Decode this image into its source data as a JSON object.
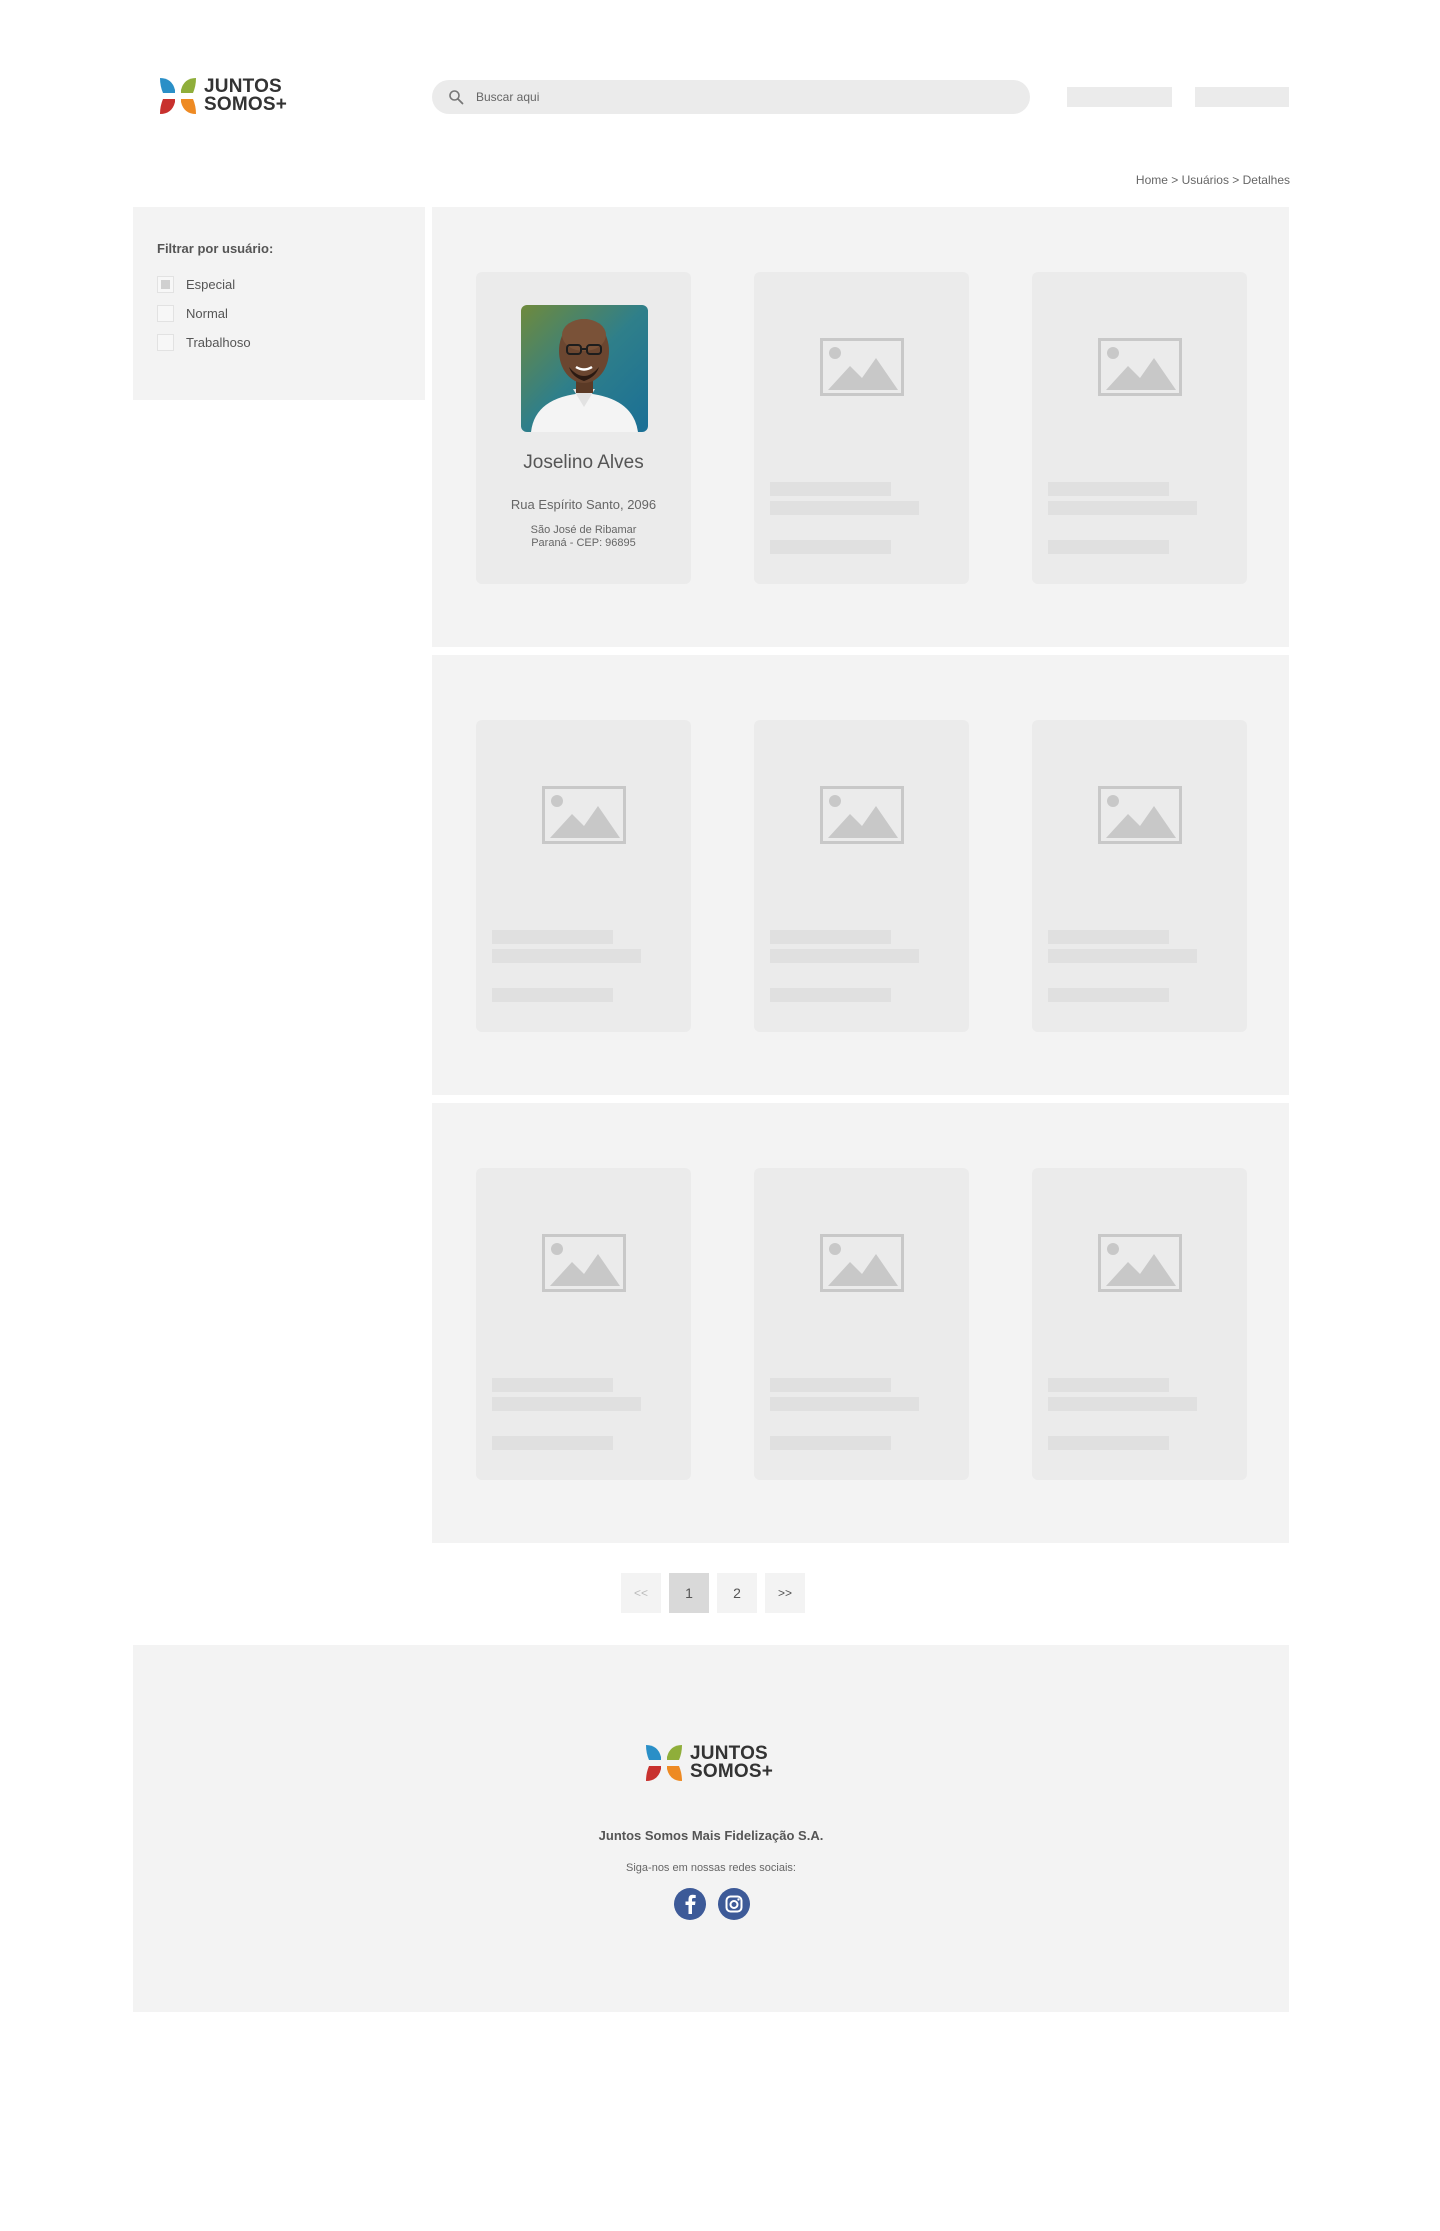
{
  "brand": {
    "line1": "JUNTOS",
    "line2": "SOMOS+",
    "colors": [
      "#2a8fc7",
      "#8fae3a",
      "#c8312e",
      "#ee8a23"
    ]
  },
  "search": {
    "placeholder": "Buscar aqui",
    "icon": "search-icon"
  },
  "breadcrumb": "Home > Usuários > Detalhes",
  "sidebar": {
    "title": "Filtrar por usuário:",
    "filters": [
      {
        "label": "Especial",
        "checked": true
      },
      {
        "label": "Normal",
        "checked": false
      },
      {
        "label": "Trabalhoso",
        "checked": false
      }
    ]
  },
  "profile": {
    "name": "Joselino Alves",
    "street": "Rua Espírito Santo, 2096",
    "city": "São José de Ribamar",
    "state_cep": "Paraná - CEP: 96895"
  },
  "pagination": {
    "prev": "<<",
    "pages": [
      "1",
      "2"
    ],
    "next": ">>",
    "active_page": "1"
  },
  "footer": {
    "company": "Juntos Somos Mais Fidelização S.A.",
    "social_label": "Siga-nos em nossas redes sociais:",
    "social_icons": [
      "facebook-icon",
      "instagram-icon"
    ],
    "social_color": "#3d5a98"
  },
  "colors": {
    "panel_bg": "#f3f3f3",
    "card_bg": "#ebebeb",
    "placeholder": "#c8c8c8",
    "text": "#555555"
  }
}
